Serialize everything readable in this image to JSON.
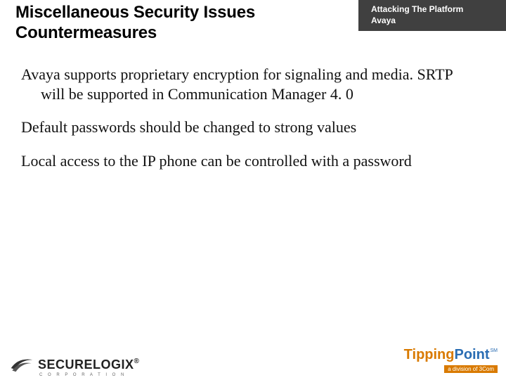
{
  "header": {
    "line1": "Attacking The Platform",
    "line2": "Avaya"
  },
  "title": "Miscellaneous Security Issues Countermeasures",
  "bullets": [
    "Avaya supports proprietary encryption for signaling and media. SRTP will be supported in Communication Manager 4. 0",
    "Default passwords should be changed to strong values",
    "Local access to the IP phone can be controlled with a password"
  ],
  "footer": {
    "left_logo_text": "SECURELOGIX",
    "left_logo_reg": "®",
    "left_logo_sub": "C O R P O R A T I O N",
    "right_logo_part1": "Tipping",
    "right_logo_part2": "Point",
    "right_logo_mark": "SM",
    "right_logo_sub": "a division of 3Com"
  }
}
